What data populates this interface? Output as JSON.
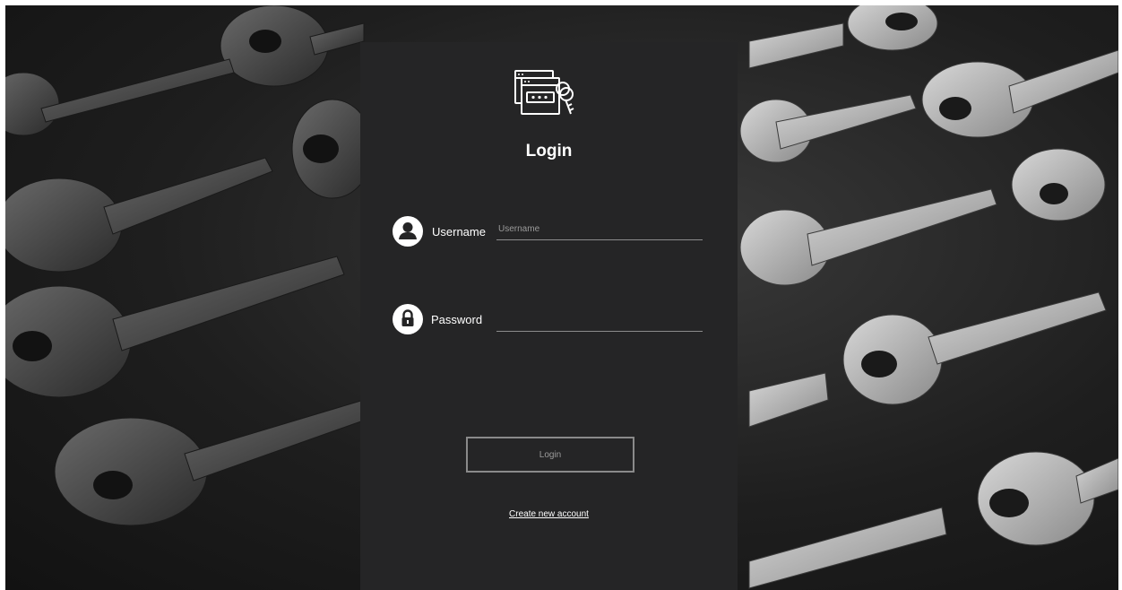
{
  "login": {
    "title": "Login",
    "username_label": "Username",
    "username_placeholder": "Username",
    "username_value": "",
    "password_label": "Password",
    "password_value": "",
    "button_label": "Login",
    "create_account_link": "Create new account"
  },
  "icons": {
    "logo": "browser-password-keys-icon",
    "username": "user-circle-icon",
    "password": "lock-circle-icon"
  },
  "colors": {
    "panel": "#252526",
    "text": "#ffffff",
    "button_border": "#8a8a8a",
    "input_underline": "#8c8c8c"
  }
}
